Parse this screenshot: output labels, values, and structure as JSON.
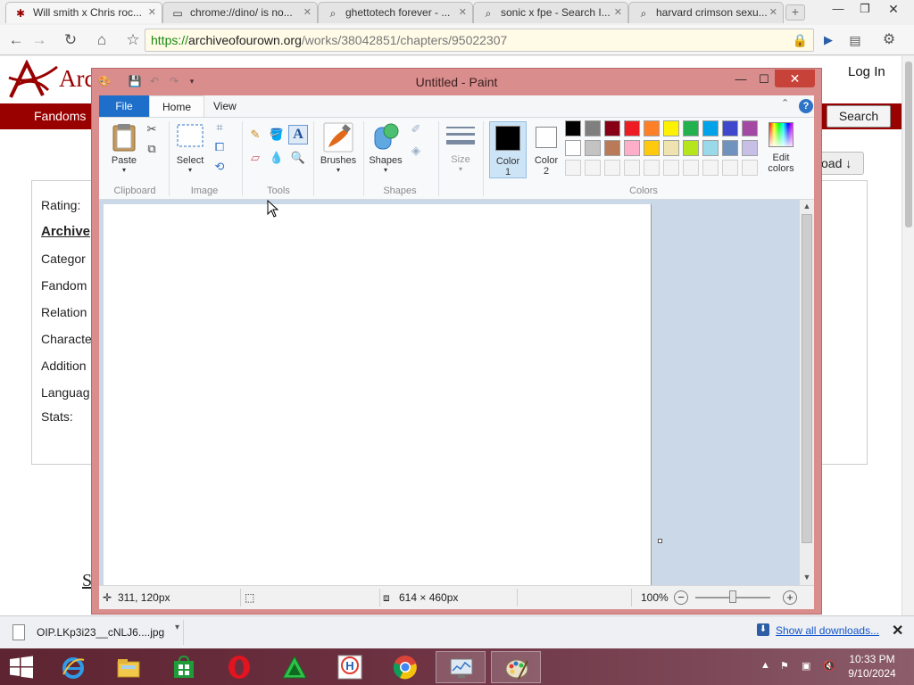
{
  "browser": {
    "tabs": [
      {
        "title": "Will smith x Chris roc...",
        "icon": "ao3-favicon"
      },
      {
        "title": "chrome://dino/ is no...",
        "icon": "page-icon"
      },
      {
        "title": "ghettotech forever - ...",
        "icon": "search-icon"
      },
      {
        "title": "sonic x fpe - Search I...",
        "icon": "search-icon"
      },
      {
        "title": "harvard crimson sexu...",
        "icon": "search-icon"
      }
    ],
    "url": {
      "scheme": "https://",
      "host": "archiveofourown.org",
      "path": "/works/38042851/chapters/95022307"
    }
  },
  "webpage": {
    "site_name": "Arc",
    "login": "Log In",
    "nav_fandoms": "Fandoms",
    "search_button": "Search",
    "download_button": "oad ↓",
    "meta_labels": [
      "Rating:",
      "Archive",
      "Categor",
      "Fandom",
      "Relation",
      "Characte",
      "Addition",
      "Languag",
      "Stats:"
    ],
    "below_text": "S"
  },
  "paint": {
    "title": "Untitled - Paint",
    "tabs": {
      "file": "File",
      "home": "Home",
      "view": "View"
    },
    "groups": {
      "clipboard": "Clipboard",
      "image": "Image",
      "tools": "Tools",
      "shapes": "Shapes",
      "colors": "Colors"
    },
    "buttons": {
      "paste": "Paste",
      "select": "Select",
      "brushes": "Brushes",
      "shapes": "Shapes",
      "size": "Size",
      "color1_line1": "Color",
      "color1_line2": "1",
      "color2_line1": "Color",
      "color2_line2": "2",
      "edit_colors_line1": "Edit",
      "edit_colors_line2": "colors"
    },
    "color1": "#000000",
    "color2": "#ffffff",
    "palette": [
      "#000000",
      "#7f7f7f",
      "#880015",
      "#ed1c24",
      "#ff7f27",
      "#fff200",
      "#22b14c",
      "#00a2e8",
      "#3f48cc",
      "#a349a4",
      "#ffffff",
      "#c3c3c3",
      "#b97a57",
      "#ffaec9",
      "#ffc90e",
      "#efe4b0",
      "#b5e61d",
      "#99d9ea",
      "#7092be",
      "#c8bfe7"
    ],
    "status": {
      "cursor_pos": "311, 120px",
      "canvas_size": "614 × 460px",
      "zoom": "100%"
    }
  },
  "downloads": {
    "file_name": "OIP.LKp3i23__cNLJ6....jpg",
    "show_all": "Show all downloads..."
  },
  "taskbar": {
    "time": "10:33 PM",
    "date": "9/10/2024"
  }
}
